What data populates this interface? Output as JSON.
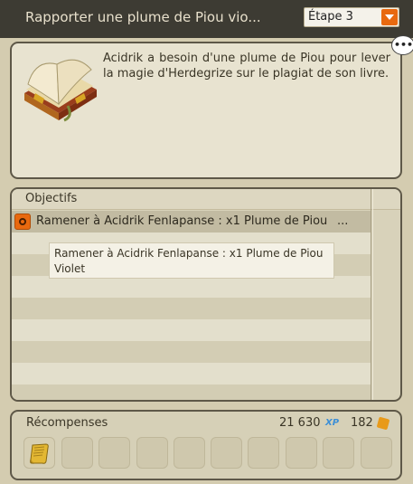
{
  "window": {
    "title": "Rapporter une plume de Piou vio..."
  },
  "step_selector": {
    "selected": "Étape 3"
  },
  "description": {
    "text": "Acidrik a besoin d'une plume de Piou pour lever la magie d'Herdegrize sur le plagiat de son livre.",
    "chat_glyph": "•••"
  },
  "objectives": {
    "header": "Objectifs",
    "items": [
      {
        "label": "Ramener à Acidrik Fenlapanse : x1 Plume de Piou",
        "ellipsis": "..."
      }
    ],
    "tooltip": "Ramener à Acidrik Fenlapanse : x1 Plume de Piou Violet"
  },
  "rewards": {
    "label": "Récompenses",
    "xp": "21 630",
    "xp_icon_text": "XP",
    "kamas": "182"
  },
  "colors": {
    "title_bg": "#3d3b33",
    "accent_orange": "#e8690f",
    "xp_blue": "#3d8fd6",
    "panel_border": "#5e5848"
  }
}
